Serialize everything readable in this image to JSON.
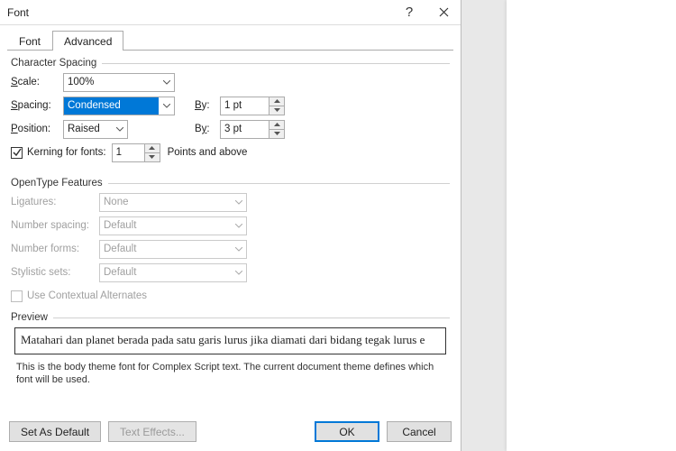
{
  "title": "Font",
  "tabs": {
    "font": "Font",
    "advanced": "Advanced"
  },
  "char_spacing": {
    "heading": "Character Spacing",
    "scale_label": "Scale:",
    "scale_value": "100%",
    "spacing_label": "Spacing:",
    "spacing_value": "Condensed",
    "by_label": "By:",
    "spacing_by": "1 pt",
    "position_label": "Position:",
    "position_value": "Raised",
    "position_by": "3 pt",
    "kerning_label": "Kerning for fonts:",
    "kerning_value": "1",
    "points_and_above": "Points and above"
  },
  "opentype": {
    "heading": "OpenType Features",
    "ligatures_label": "Ligatures:",
    "ligatures_value": "None",
    "numspacing_label": "Number spacing:",
    "numspacing_value": "Default",
    "numforms_label": "Number forms:",
    "numforms_value": "Default",
    "styl_label": "Stylistic sets:",
    "styl_value": "Default",
    "contextual_label": "Use Contextual Alternates"
  },
  "preview": {
    "heading": "Preview",
    "text": "Matahari dan planet berada pada satu garis lurus jika diamati dari bidang tegak lurus e",
    "note": "This is the body theme font for Complex Script text. The current document theme defines which font will be used."
  },
  "buttons": {
    "set_default": "Set As Default",
    "text_effects": "Text Effects...",
    "ok": "OK",
    "cancel": "Cancel"
  }
}
